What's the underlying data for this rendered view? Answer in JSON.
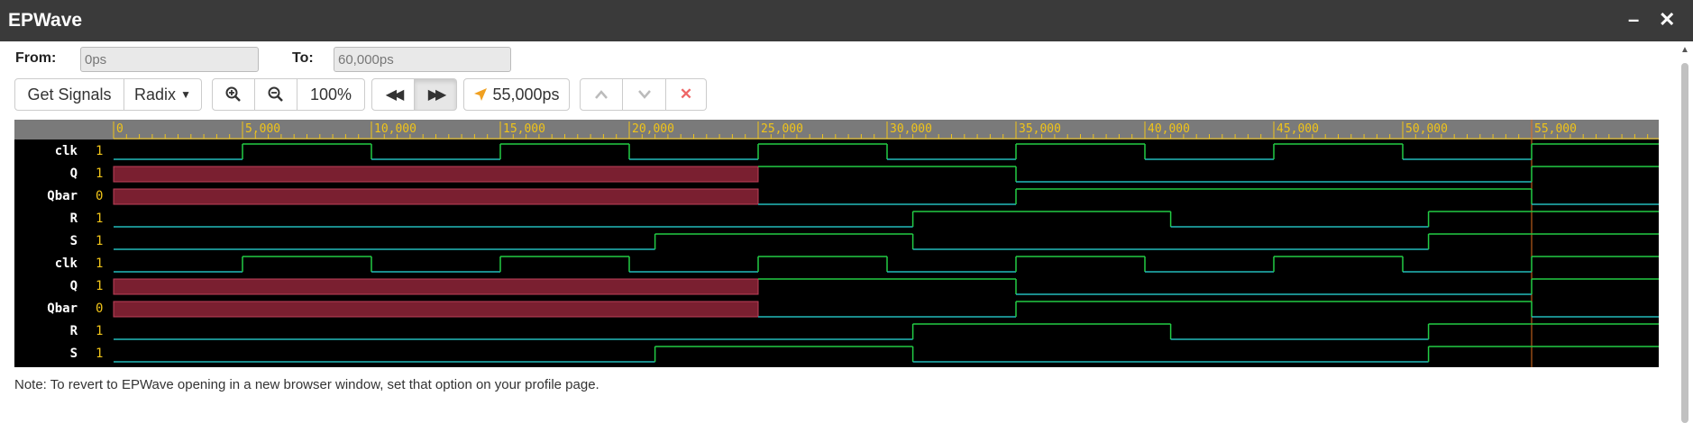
{
  "window": {
    "title": "EPWave",
    "minimize_icon": "minimize-icon",
    "close_icon": "close-icon"
  },
  "range": {
    "from_label": "From:",
    "from_value": "0ps",
    "to_label": "To:",
    "to_value": "60,000ps"
  },
  "toolbar": {
    "get_signals": "Get Signals",
    "radix": "Radix",
    "zoom_level": "100%",
    "cursor_time": "55,000ps",
    "icons": [
      "zoom-in-icon",
      "zoom-out-icon",
      "rewind-icon",
      "fast-forward-icon",
      "cursor-icon",
      "up-icon",
      "down-icon",
      "delete-icon"
    ]
  },
  "colors": {
    "accent": "#f0c419",
    "high": "#22cc44",
    "low": "#22bbbb",
    "undefined": "#7a1f30",
    "cursor": "#e07020",
    "timeline_bg": "#7a7a7a"
  },
  "timeline": {
    "ticks": [
      "0",
      "5,000",
      "10,000",
      "15,000",
      "20,000",
      "25,000",
      "30,000",
      "35,000",
      "40,000",
      "45,000",
      "50,000",
      "55,000"
    ],
    "end": 60000,
    "cursor": 55000
  },
  "signals": [
    {
      "name": "clk",
      "value": "1",
      "type": "clock"
    },
    {
      "name": "Q",
      "value": "1",
      "type": "q"
    },
    {
      "name": "Qbar",
      "value": "0",
      "type": "qbar"
    },
    {
      "name": "R",
      "value": "1",
      "type": "r"
    },
    {
      "name": "S",
      "value": "1",
      "type": "s"
    },
    {
      "name": "clk",
      "value": "1",
      "type": "clock"
    },
    {
      "name": "Q",
      "value": "1",
      "type": "q"
    },
    {
      "name": "Qbar",
      "value": "0",
      "type": "qbar"
    },
    {
      "name": "R",
      "value": "1",
      "type": "r"
    },
    {
      "name": "S",
      "value": "1",
      "type": "s"
    }
  ],
  "note": "Note: To revert to EPWave opening in a new browser window, set that option on your profile page."
}
